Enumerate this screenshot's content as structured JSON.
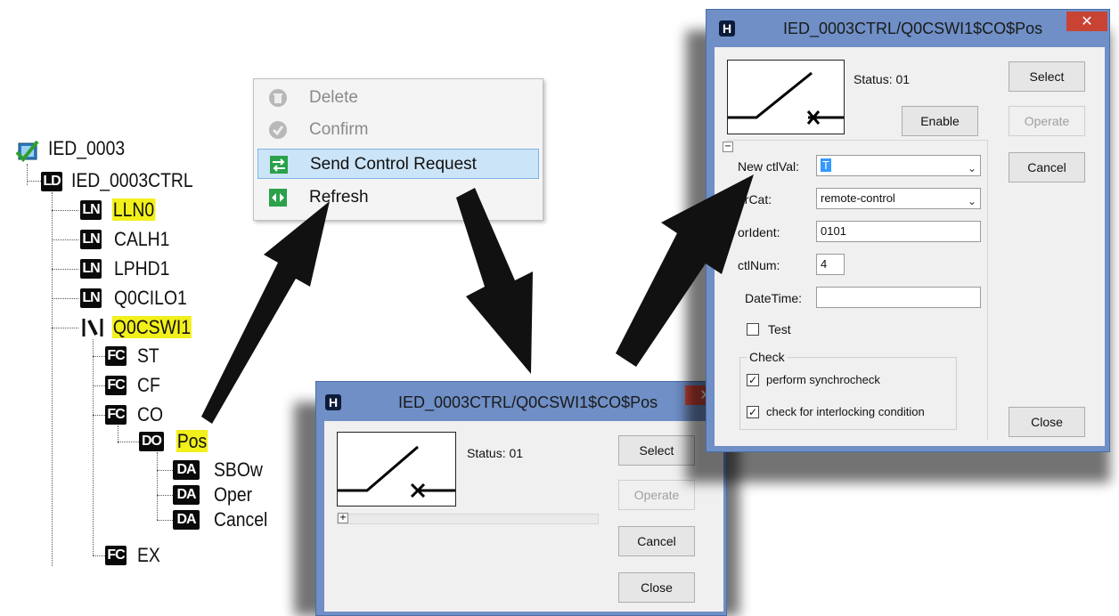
{
  "tree": {
    "root": "IED_0003",
    "ld": "IED_0003CTRL",
    "nodes": [
      {
        "badge": "LN",
        "label": "LLN0"
      },
      {
        "badge": "LN",
        "label": "CALH1"
      },
      {
        "badge": "LN",
        "label": "LPHD1"
      },
      {
        "badge": "LN",
        "label": "Q0CILO1"
      },
      {
        "badge": "switch",
        "label": "Q0CSWI1"
      },
      {
        "badge": "FC",
        "label": "ST"
      },
      {
        "badge": "FC",
        "label": "CF"
      },
      {
        "badge": "FC",
        "label": "CO"
      },
      {
        "badge": "DO",
        "label": "Pos"
      },
      {
        "badge": "DA",
        "label": "SBOw"
      },
      {
        "badge": "DA",
        "label": "Oper"
      },
      {
        "badge": "DA",
        "label": "Cancel"
      },
      {
        "badge": "FC",
        "label": "EX"
      }
    ],
    "badges": {
      "ld": "LD",
      "ln": "LN",
      "fc": "FC",
      "do": "DO",
      "da": "DA"
    }
  },
  "context_menu": {
    "items": [
      {
        "label": "Delete",
        "icon": "trash-icon",
        "enabled": false
      },
      {
        "label": "Confirm",
        "icon": "check-icon",
        "enabled": false
      },
      {
        "label": "Send Control Request",
        "icon": "send-control-icon",
        "enabled": true,
        "selected": true
      },
      {
        "label": "Refresh",
        "icon": "refresh-icon",
        "enabled": true
      }
    ]
  },
  "dialog_small": {
    "title": "IED_0003CTRL/Q0CSWI1$CO$Pos",
    "app_icon": "H",
    "close": "✕",
    "status": "Status: 01",
    "expander": "+",
    "buttons": {
      "select": "Select",
      "operate": "Operate",
      "cancel": "Cancel",
      "close": "Close"
    }
  },
  "dialog_large": {
    "title": "IED_0003CTRL/Q0CSWI1$CO$Pos",
    "app_icon": "H",
    "close": "✕",
    "status": "Status: 01",
    "expander": "−",
    "enable": "Enable",
    "fields": {
      "new_ctlval_label": "New ctlVal:",
      "new_ctlval_value": "T",
      "orcat_label": "orCat:",
      "orcat_value": "remote-control",
      "orident_label": "orIdent:",
      "orident_value": "0101",
      "ctlnum_label": "ctlNum:",
      "ctlnum_value": "4",
      "datetime_label": "DateTime:",
      "datetime_value": ""
    },
    "test_label": "Test",
    "check_group": "Check",
    "synchrocheck_label": "perform synchrocheck",
    "interlock_label": "check for interlocking condition",
    "buttons": {
      "select": "Select",
      "operate": "Operate",
      "cancel": "Cancel",
      "close": "Close"
    }
  },
  "colors": {
    "highlight": "#f2f01a",
    "dialog_frame": "#6f8fc6",
    "close_red": "#c94335",
    "menu_selected": "#cce4f7",
    "arrow": "#111111"
  }
}
